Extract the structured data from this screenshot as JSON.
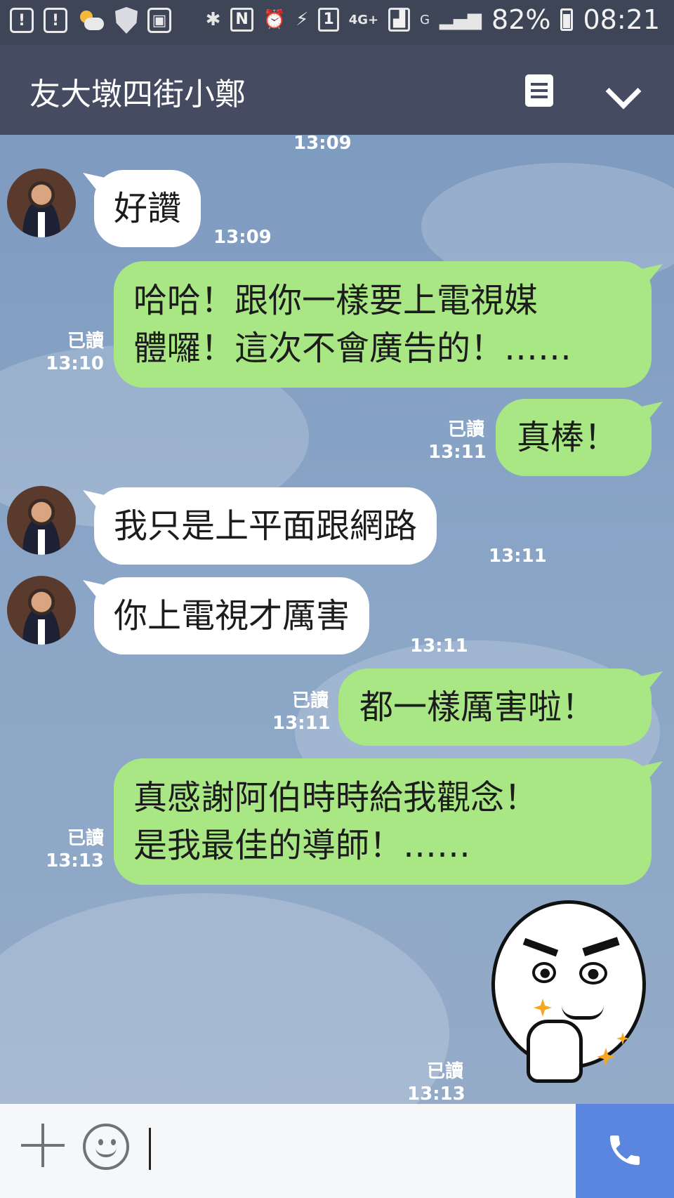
{
  "status_bar": {
    "battery_percent": "82%",
    "time": "08:21",
    "network_4g": "4G+",
    "sim_badge": "1",
    "g_label": "G"
  },
  "header": {
    "title": "友大墩四街小鄭"
  },
  "chat": {
    "top_partial_time": "13:09",
    "messages": [
      {
        "side": "in",
        "text": "好讚",
        "time": "13:09"
      },
      {
        "side": "out",
        "text_lines": [
          "哈哈！跟你一樣要上電視媒",
          "體囉！這次不會廣告的！……"
        ],
        "read": "已讀",
        "time": "13:10"
      },
      {
        "side": "out",
        "text": "真棒！",
        "read": "已讀",
        "time": "13:11"
      },
      {
        "side": "in",
        "text": "我只是上平面跟網路",
        "time": "13:11"
      },
      {
        "side": "in",
        "text": "你上電視才厲害",
        "time": "13:11"
      },
      {
        "side": "out",
        "text": "都一樣厲害啦！",
        "read": "已讀",
        "time": "13:11"
      },
      {
        "side": "out",
        "text_lines": [
          "真感謝阿伯時時給我觀念！",
          "是我最佳的導師！……"
        ],
        "read": "已讀",
        "time": "13:13"
      },
      {
        "side": "out",
        "sticker": "thumbs-up-smirk-sticker",
        "read": "已讀",
        "time": "13:13"
      }
    ]
  },
  "input": {
    "value": "",
    "placeholder": ""
  },
  "colors": {
    "header": "#454b61",
    "outgoing_bubble": "#a9e784",
    "incoming_bubble": "#ffffff",
    "call_button": "#5b86df"
  }
}
